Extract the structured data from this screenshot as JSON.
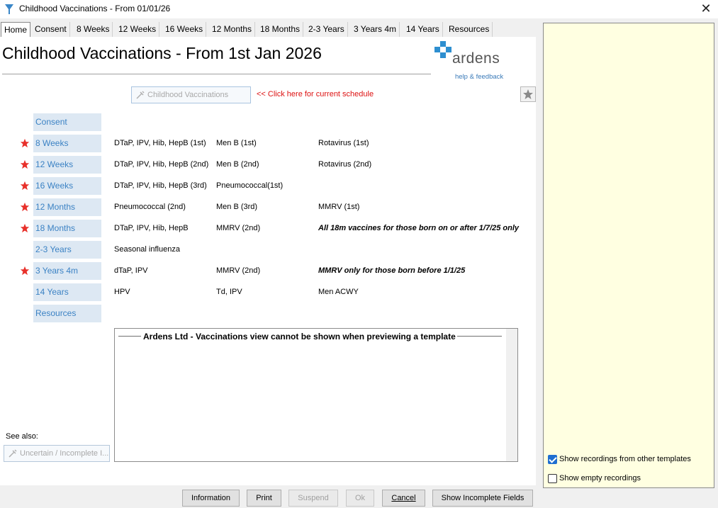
{
  "window": {
    "title": "Childhood Vaccinations - From 01/01/26",
    "close_glyph": "✕"
  },
  "tabs": [
    "Home",
    "Consent",
    "8 Weeks",
    "12 Weeks",
    "16 Weeks",
    "12 Months",
    "18 Months",
    "2-3 Years",
    "3 Years 4m",
    "14 Years",
    "Resources"
  ],
  "header": {
    "title": "Childhood Vaccinations - From 1st Jan 2026",
    "logo_word": "ardens",
    "logo_link": "help & feedback"
  },
  "schedule": {
    "button_label": "Childhood Vaccinations",
    "link_text": "<< Click here for current schedule"
  },
  "rows": [
    {
      "label": "Consent",
      "starred": false,
      "c1": "",
      "c2": "",
      "c3": "",
      "c3_note": false
    },
    {
      "label": "8 Weeks",
      "starred": true,
      "c1": "DTaP, IPV, Hib, HepB  (1st)",
      "c2": "Men B (1st)",
      "c3": "Rotavirus (1st)",
      "c3_note": false
    },
    {
      "label": "12 Weeks",
      "starred": true,
      "c1": "DTaP, IPV, Hib, HepB (2nd)",
      "c2": "Men B (2nd)",
      "c3": "Rotavirus (2nd)",
      "c3_note": false
    },
    {
      "label": "16 Weeks",
      "starred": true,
      "c1": "DTaP, IPV, Hib, HepB (3rd)",
      "c2": "Pneumococcal(1st)",
      "c3": "",
      "c3_note": false
    },
    {
      "label": "12 Months",
      "starred": true,
      "c1": "Pneumococcal (2nd)",
      "c2": "Men B (3rd)",
      "c3": "MMRV (1st)",
      "c3_note": false
    },
    {
      "label": "18 Months",
      "starred": true,
      "c1": "DTaP, IPV, Hib, HepB",
      "c2": "MMRV (2nd)",
      "c3": "All 18m vaccines for those born on or after 1/7/25 only",
      "c3_note": true
    },
    {
      "label": "2-3 Years",
      "starred": false,
      "c1": "Seasonal influenza",
      "c2": "",
      "c3": "",
      "c3_note": false
    },
    {
      "label": "3 Years 4m",
      "starred": true,
      "c1": "dTaP, IPV",
      "c2": "MMRV (2nd)",
      "c3": "MMRV only for those born before 1/1/25",
      "c3_note": true
    },
    {
      "label": "14 Years",
      "starred": false,
      "c1": "HPV",
      "c2": "Td, IPV",
      "c3": "Men ACWY",
      "c3_note": false
    },
    {
      "label": "Resources",
      "starred": false,
      "c1": "",
      "c2": "",
      "c3": "",
      "c3_note": false
    }
  ],
  "vaccinations_view": {
    "legend": "Ardens Ltd - Vaccinations view cannot be shown when previewing a template"
  },
  "see_also": {
    "label": "See also:",
    "button_label": "Uncertain / Incomplete I..."
  },
  "right_panel": {
    "show_other_templates": {
      "label": "Show recordings from other templates",
      "checked": true
    },
    "show_empty": {
      "label": "Show empty recordings",
      "checked": false
    }
  },
  "buttons": {
    "information": "Information",
    "print": "Print",
    "suspend": "Suspend",
    "ok": "Ok",
    "cancel": "Cancel",
    "show_incomplete": "Show Incomplete Fields"
  },
  "colors": {
    "star": "#e8302a",
    "label_bg": "#dde8f3",
    "label_text": "#3b82c4",
    "panel_bg": "#ffffe1",
    "logo_cross": "#2e8fd0"
  }
}
